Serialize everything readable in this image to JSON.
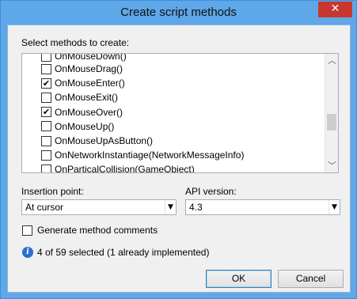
{
  "window": {
    "title": "Create script methods",
    "close_glyph": "✕"
  },
  "methods": {
    "label": "Select methods to create:",
    "items": [
      {
        "label": "OnMouseDown()",
        "checked": false
      },
      {
        "label": "OnMouseDrag()",
        "checked": false
      },
      {
        "label": "OnMouseEnter()",
        "checked": true
      },
      {
        "label": "OnMouseExit()",
        "checked": false
      },
      {
        "label": "OnMouseOver()",
        "checked": true
      },
      {
        "label": "OnMouseUp()",
        "checked": false
      },
      {
        "label": "OnMouseUpAsButton()",
        "checked": false
      },
      {
        "label": "OnNetworkInstantiage(NetworkMessageInfo)",
        "checked": false
      },
      {
        "label": "OnParticalCollision(GameObject)",
        "checked": false
      }
    ],
    "scrollbar": {
      "up_glyph": "︿",
      "down_glyph": "﹀"
    }
  },
  "insertion": {
    "label": "Insertion point:",
    "value": "At cursor"
  },
  "api": {
    "label": "API version:",
    "value": "4.3"
  },
  "combo_arrow_glyph": "▼",
  "generate_comments": {
    "label": "Generate method comments",
    "checked": false
  },
  "status": {
    "icon": "info-icon",
    "text": "4 of 59 selected (1 already implemented)"
  },
  "buttons": {
    "ok": "OK",
    "cancel": "Cancel"
  },
  "colors": {
    "title_bar": "#5ea7e8",
    "close_button": "#c7372f",
    "info_icon": "#2a6fcd"
  }
}
